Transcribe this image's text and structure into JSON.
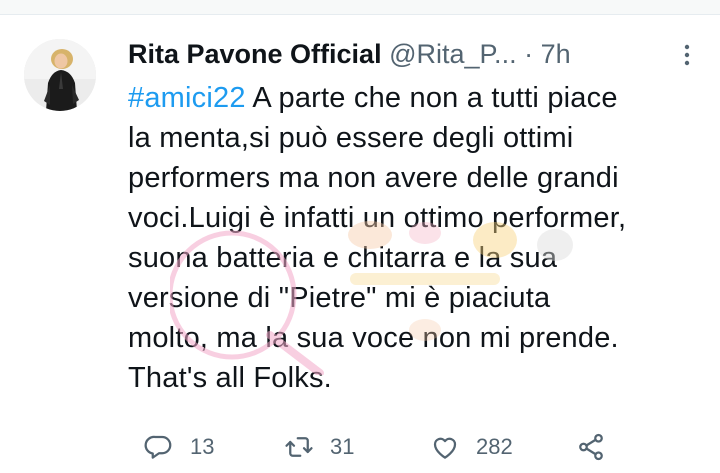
{
  "tweet": {
    "display_name": "Rita Pavone Official",
    "handle": "@Rita_P...",
    "separator": "·",
    "time": "7h",
    "hashtag": "#amici22",
    "text_after_hashtag": " A parte che non a tutti piace\nla menta,si può essere degli ottimi\nperformers ma non avere delle grandi\nvoci.Luigi è infatti un ottimo performer,\nsuona batteria e chitarra e la sua\nversione di \"Pietre\" mi è piaciuta\nmolto, ma la sua voce non mi prende.\nThat's all Folks.",
    "avatar_icon": "profile-photo",
    "more_icon": "more-vertical-icon"
  },
  "actions": {
    "reply_count": "13",
    "retweet_count": "31",
    "like_count": "282"
  },
  "colors": {
    "link": "#1d9bf0",
    "text": "#0f1419",
    "muted": "#536471"
  }
}
